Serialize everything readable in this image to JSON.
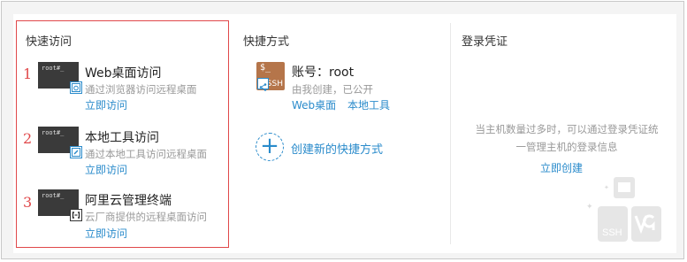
{
  "quick_access": {
    "title": "快速访问",
    "items": [
      {
        "num": "1",
        "prompt": "root#_",
        "title": "Web桌面访问",
        "desc": "通过浏览器访问远程桌面",
        "link": "立即访问",
        "badge_icon": "browser-icon"
      },
      {
        "num": "2",
        "prompt": "root#_",
        "title": "本地工具访问",
        "desc": "通过本地工具访问远程桌面",
        "link": "立即访问",
        "badge_icon": "edit-icon"
      },
      {
        "num": "3",
        "prompt": "root#_",
        "title": "阿里云管理终端",
        "desc": "云厂商提供的远程桌面访问",
        "link": "立即访问",
        "badge_icon": "aliyun-icon"
      }
    ]
  },
  "shortcuts": {
    "title": "快捷方式",
    "account": {
      "tile_top": "$_",
      "tile_bottom": "SSH",
      "name": "账号：root",
      "meta": "由我创建，已公开",
      "links": [
        "Web桌面",
        "本地工具"
      ]
    },
    "create_label": "创建新的快捷方式"
  },
  "credentials": {
    "title": "登录凭证",
    "desc_line1": "当主机数量过多时，可以通过登录凭证统",
    "desc_line2": "一管理主机的登录信息",
    "create_link": "立即创建",
    "decor_ssh": "SSH"
  },
  "colors": {
    "accent": "#2a8bcb",
    "highlight": "#e0484a",
    "ssh_tile": "#b5754a"
  }
}
